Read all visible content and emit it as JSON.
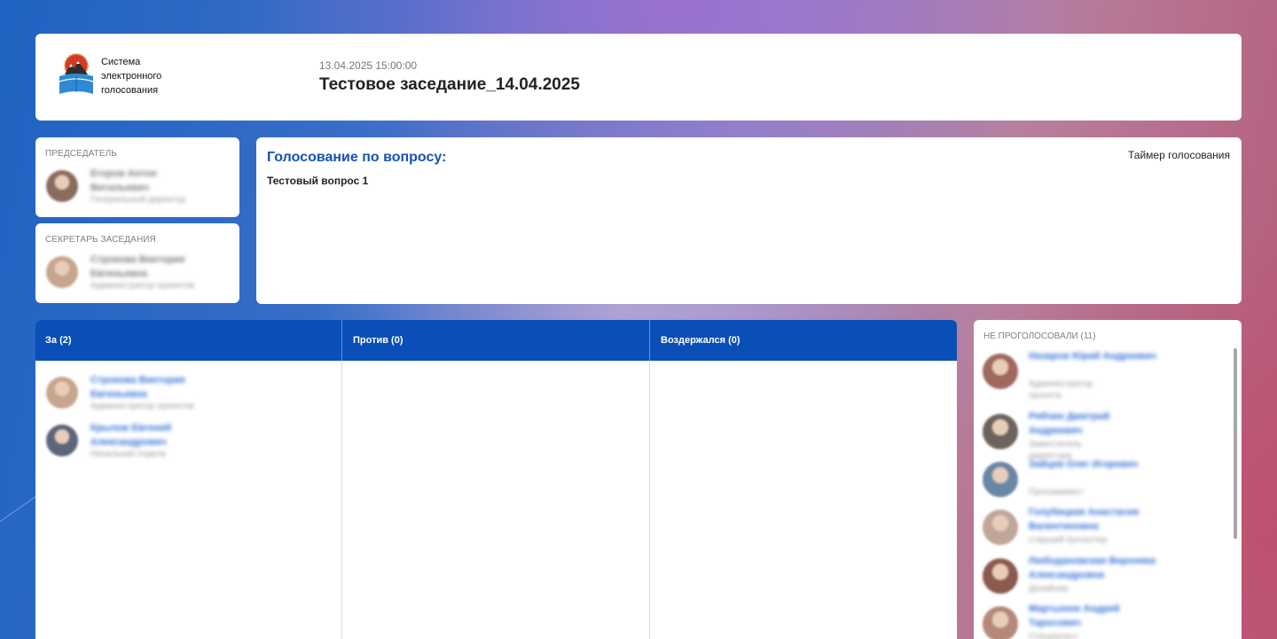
{
  "header": {
    "logo_text_lines": [
      "Система",
      "электронного",
      "голосования"
    ],
    "meeting_date": "13.04.2025 15:00:00",
    "meeting_title": "Тестовое заседание_14.04.2025"
  },
  "chair": {
    "label": "Председатель",
    "name": "Егоров Антон Витальевич",
    "position": "Генеральный директор",
    "avatar_color": "#8a6c5c"
  },
  "secretary": {
    "label": "Секретарь заседания",
    "name": "Строкова Виктория Евгеньевна",
    "position": "Администратор проектов",
    "avatar_color": "#c7a58e"
  },
  "question": {
    "heading": "Голосование по вопросу:",
    "text": "Тестовый вопрос 1",
    "timer_label": "Таймер голосования"
  },
  "votes": {
    "columns": [
      {
        "title": "За (2)",
        "people": [
          {
            "name": "Строкова Виктория Евгеньевна",
            "position": "Администратор проектов",
            "avatar_color": "#c7a58e"
          },
          {
            "name": "Крылов Евгений Александрович",
            "position": "Начальник отдела",
            "avatar_color": "#5b6678"
          }
        ]
      },
      {
        "title": "Против (0)",
        "people": []
      },
      {
        "title": "Воздержался (0)",
        "people": []
      }
    ]
  },
  "not_voted": {
    "label": "Не проголосовали (11)",
    "people": [
      {
        "name": "Назаров Юрий Андреевич",
        "position": "Администратор проекта",
        "avatar_color": "#a0685e"
      },
      {
        "name": "Рябчин Дмитрий Андреевич",
        "position": "Заместитель директора",
        "avatar_color": "#6d625d"
      },
      {
        "name": "Зайцев Олег Игоревич",
        "position": "Программист",
        "avatar_color": "#6a86a6"
      },
      {
        "name": "Голубицкая Анастасия Валентиновна",
        "position": "старший бухгалтер",
        "avatar_color": "#c0a69a"
      },
      {
        "name": "Любодановская Вероника Александровна",
        "position": "Дизайнер",
        "avatar_color": "#8a5a4e"
      },
      {
        "name": "Мартынюк Андрей Таросович",
        "position": "Специалист",
        "avatar_color": "#b5887a"
      }
    ]
  }
}
